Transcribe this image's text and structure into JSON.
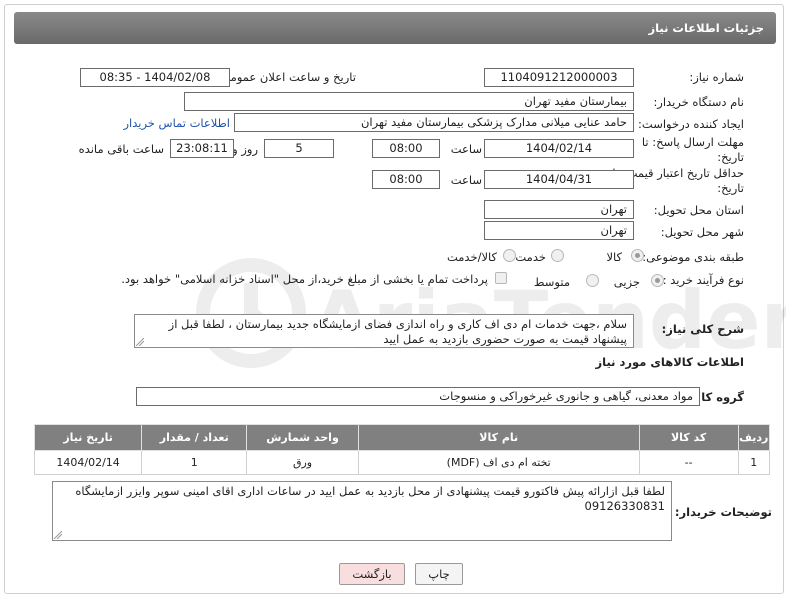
{
  "header": {
    "title": "جزئیات اطلاعات نیاز"
  },
  "fields": {
    "need_number_label": "شماره نیاز:",
    "need_number": "1104091212000003",
    "announce_label": "تاریخ و ساعت اعلان عمومی:",
    "announce_value": "1404/02/08 - 08:35",
    "buyer_org_label": "نام دستگاه خریدار:",
    "buyer_org": "بیمارستان مفید تهران",
    "creator_label": "ایجاد کننده درخواست:",
    "creator": "حامد عنایی میلانی مدارک پزشکی بیمارستان مفید تهران",
    "contact_link": "اطلاعات تماس خریدار",
    "deadline_label": "مهلت ارسال پاسخ: تا تاریخ:",
    "deadline_date": "1404/02/14",
    "time_word": "ساعت",
    "deadline_time": "08:00",
    "days_count": "5",
    "days_word": "روز و",
    "remaining_time": "23:08:11",
    "remaining_word": "ساعت باقی مانده",
    "validity_label": "حداقل تاریخ اعتبار قیمت: تا تاریخ:",
    "validity_date": "1404/04/31",
    "validity_time": "08:00",
    "province_label": "استان محل تحویل:",
    "province": "تهران",
    "city_label": "شهر محل تحویل:",
    "city": "تهران",
    "category_label": "طبقه بندی موضوعی:",
    "cat_goods": "کالا",
    "cat_service": "خدمت",
    "cat_both": "کالا/خدمت",
    "process_label": "نوع فرآیند خرید :",
    "proc_partial": "جزیی",
    "proc_medium": "متوسط",
    "payment_note": "پرداخت تمام یا بخشی از مبلغ خرید،از محل \"اسناد خزانه اسلامی\" خواهد بود."
  },
  "description": {
    "label": "شرح کلی نیاز:",
    "text": "سلام ،جهت خدمات  ام دی اف کاری و راه اندازی فضای ازمایشگاه جدید بیمارستان ، لطفا قبل از پیشنهاد قیمت به صورت حضوری بازدید به عمل ایید"
  },
  "goods_section": {
    "title": "اطلاعات کالاهای مورد نیاز",
    "group_label": "گروه کالا:",
    "group_value": "مواد معدنی، گیاهی و جانوری غیرخوراکی و منسوجات"
  },
  "table": {
    "headers": [
      "ردیف",
      "کد کالا",
      "نام کالا",
      "واحد شمارش",
      "تعداد / مقدار",
      "تاریخ نیاز"
    ],
    "rows": [
      [
        "1",
        "--",
        "تخته ام دی اف (MDF)",
        "ورق",
        "1",
        "1404/02/14"
      ]
    ]
  },
  "buyer_notes": {
    "label": "توضیحات خریدار:",
    "text": "لطفا قبل ازارائه پیش فاکتورو   قیمت پیشنهادی از محل بازدید به عمل ایید   در ساعات اداری  اقای امینی سوپر وایزر ازمایشگاه 09126330831"
  },
  "buttons": {
    "print": "چاپ",
    "back": "بازگشت"
  },
  "colors": {
    "header_bg": "#777777",
    "link": "#2255aa",
    "table_header": "#808080",
    "back_button": "#f8dede"
  },
  "watermark": {
    "text": "AriaTender.neT"
  }
}
